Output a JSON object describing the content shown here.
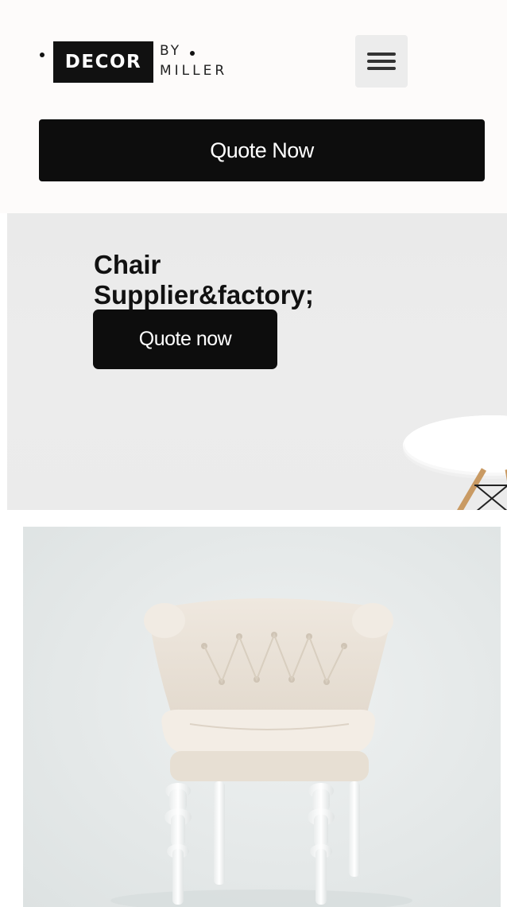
{
  "header": {
    "logo": {
      "word": "DECOR",
      "by": "BY",
      "name": "MILLER"
    },
    "menu_icon": "hamburger-menu-icon",
    "quote_button_label": "Quote Now"
  },
  "hero": {
    "title_line1": "Chair",
    "title_line2": "Supplier&factory;",
    "button_label": "Quote now",
    "decor": "white-side-table"
  },
  "product": {
    "image": "tufted-cream-armchair"
  },
  "colors": {
    "header_bg": "#fdfbfa",
    "button_bg": "#0d0d0d",
    "button_text": "#ffffff",
    "hero_bg": "#eaeaea",
    "product_bg": "#e4e8e8"
  }
}
